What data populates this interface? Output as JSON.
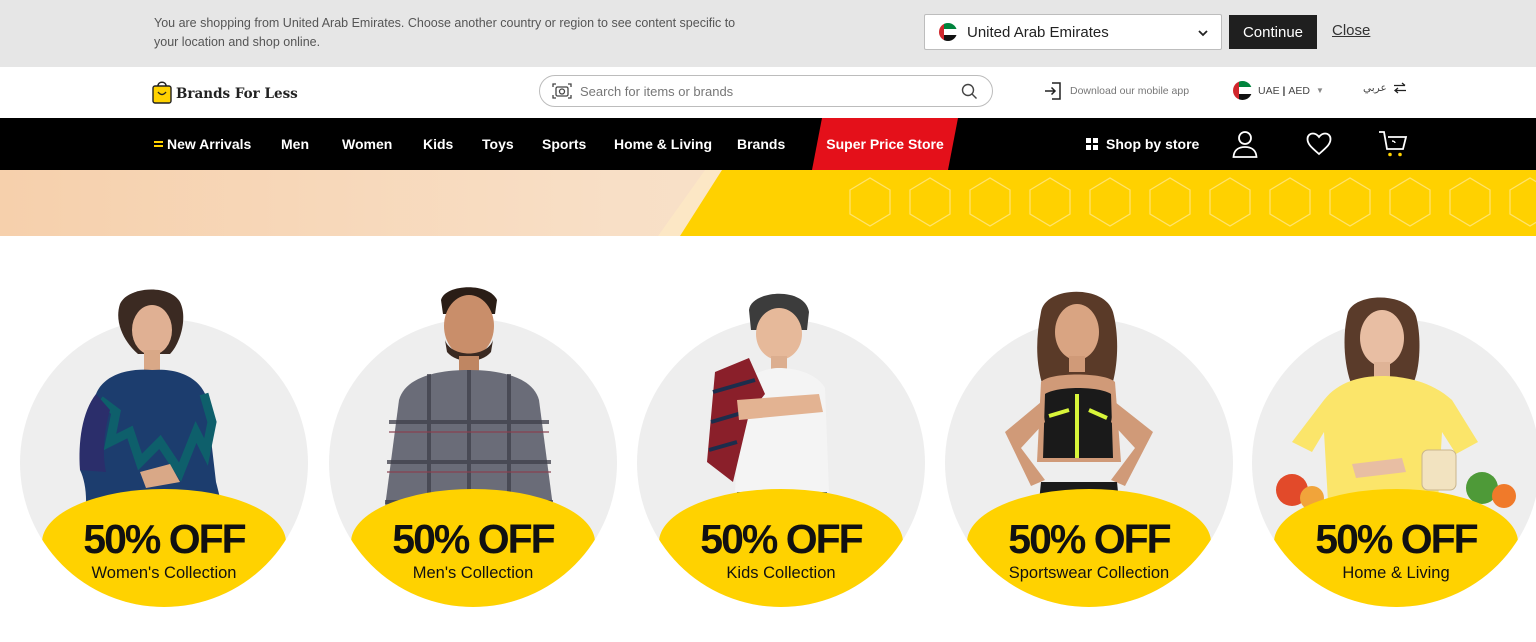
{
  "country_bar": {
    "message": "You are shopping from United Arab Emirates. Choose another country or region to see content specific to your location and shop online.",
    "selected_country": "United Arab Emirates",
    "continue_label": "Continue",
    "close_label": "Close"
  },
  "header": {
    "logo_text": "Brands For Less",
    "search_placeholder": "Search for items or brands",
    "app_link": "Download our mobile app",
    "locale_country": "UAE",
    "locale_separator": "|",
    "locale_currency": "AED",
    "language_toggle": "عربي"
  },
  "nav": {
    "items": [
      "New Arrivals",
      "Men",
      "Women",
      "Kids",
      "Toys",
      "Sports",
      "Home & Living",
      "Brands"
    ],
    "super_price": "Super Price Store",
    "shop_by_store": "Shop by store"
  },
  "categories": [
    {
      "offer": "50% OFF",
      "label": "Women's Collection"
    },
    {
      "offer": "50% OFF",
      "label": "Men's Collection"
    },
    {
      "offer": "50% OFF",
      "label": "Kids Collection"
    },
    {
      "offer": "50% OFF",
      "label": "Sportswear Collection"
    },
    {
      "offer": "50% OFF",
      "label": "Home & Living"
    }
  ],
  "icons": {
    "logo": "shopping-bag-icon",
    "search_camera": "camera-icon",
    "search": "search-icon",
    "app": "login-arrow-icon",
    "flag": "uae-flag-icon",
    "language": "swap-arrows-icon",
    "account": "user-icon",
    "wishlist": "heart-icon",
    "cart": "cart-icon",
    "store": "grid-icon"
  },
  "colors": {
    "brand_yellow": "#ffd200",
    "nav_black": "#000000",
    "super_price_red": "#e4101a",
    "country_bar_bg": "#e6e6e6"
  }
}
